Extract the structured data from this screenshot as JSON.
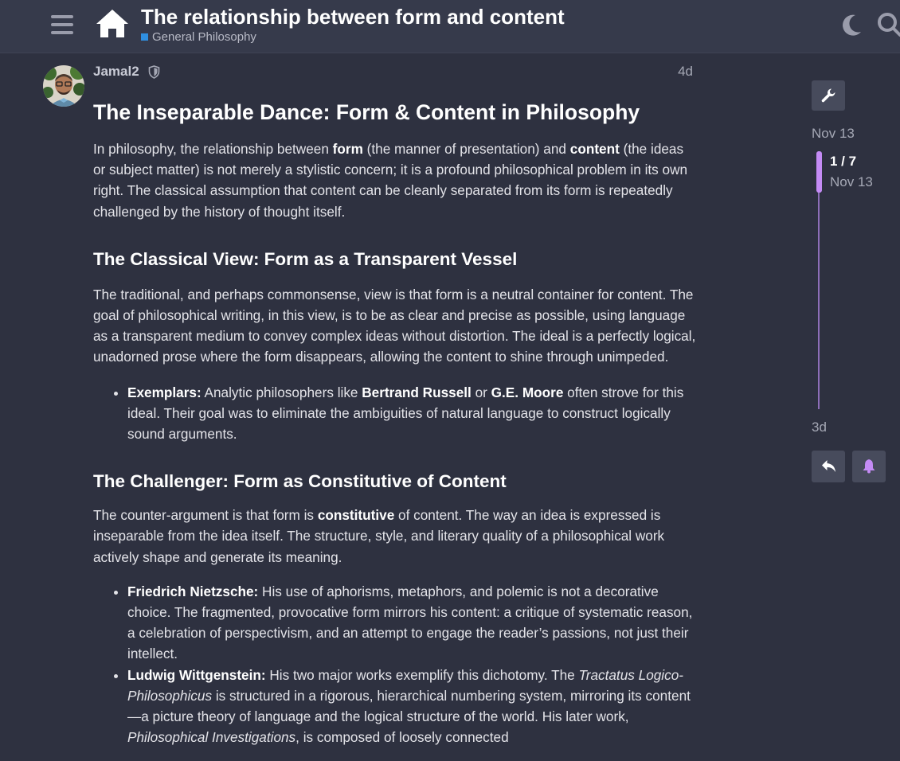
{
  "header": {
    "title": "The relationship between form and content",
    "category": "General Philosophy",
    "category_color": "#2f8fe0",
    "icons": [
      "hamburger-icon",
      "home-icon",
      "moon-icon",
      "search-icon"
    ]
  },
  "post": {
    "author": "Jamal2",
    "author_badge_icon": "shield-icon",
    "age": "4d",
    "heading": "The Inseparable Dance: Form & Content in Philosophy",
    "intro": {
      "t1": "In philosophy, the relationship between ",
      "b1": "form",
      "t2": " (the manner of presentation) and ",
      "b2": "content",
      "t3": " (the ideas or subject matter) is not merely a stylistic concern; it is a profound philosophical problem in its own right. The classical assumption that content can be cleanly separated from its form is repeatedly challenged by the history of thought itself."
    },
    "section1": {
      "heading": "The Classical View: Form as a Transparent Vessel",
      "paragraph": "The traditional, and perhaps commonsense, view is that form is a neutral container for content. The goal of philosophical writing, in this view, is to be as clear and precise as possible, using language as a transparent medium to convey complex ideas without distortion. The ideal is a perfectly logical, unadorned prose where the form disappears, allowing the content to shine through unimpeded.",
      "bullet": {
        "label": "Exemplars:",
        "t1": " Analytic philosophers like ",
        "b1": "Bertrand Russell",
        "t2": " or ",
        "b2": "G.E. Moore",
        "t3": " often strove for this ideal. Their goal was to eliminate the ambiguities of natural language to construct logically sound arguments."
      }
    },
    "section2": {
      "heading": "The Challenger: Form as Constitutive of Content",
      "p_t1": "The counter-argument is that form is ",
      "p_b1": "constitutive",
      "p_t2": " of content. The way an idea is expressed is inseparable from the idea itself. The structure, style, and literary quality of a philosophical work actively shape and generate its meaning.",
      "bullet1": {
        "label": "Friedrich Nietzsche:",
        "text": " His use of aphorisms, metaphors, and polemic is not a decorative choice. The fragmented, provocative form mirrors his content: a critique of systematic reason, a celebration of perspectivism, and an attempt to engage the reader’s passions, not just their intellect."
      },
      "bullet2": {
        "label": "Ludwig Wittgenstein:",
        "t1": " His two major works exemplify this dichotomy. The ",
        "i1": "Tractatus Logico-Philosophicus",
        "t2": " is structured in a rigorous, hierarchical numbering system, mirroring its content—a picture theory of language and the logical structure of the world. His later work, ",
        "i2": "Philosophical Investigations",
        "t3": ", is composed of loosely connected"
      }
    }
  },
  "timeline": {
    "start_date": "Nov 13",
    "position": "1 / 7",
    "position_date": "Nov 13",
    "end_date": "3d",
    "admin_icon": "wrench-icon",
    "reply_icon": "reply-icon",
    "notify_icon": "bell-icon",
    "accent_color": "#c48bf5"
  }
}
